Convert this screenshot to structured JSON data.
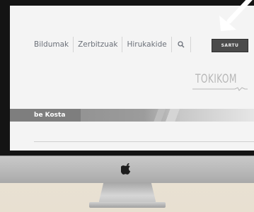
{
  "nav": {
    "items": [
      {
        "label": "Bildumak"
      },
      {
        "label": "Zerbitzuak"
      },
      {
        "label": "Hirukakide"
      }
    ],
    "search_icon": "search-icon",
    "login_label": "SARTU"
  },
  "logo": {
    "text": "TOKIKOM"
  },
  "banner": {
    "title": "be Kosta"
  },
  "hardware": {
    "logo_icon": "apple-logo-icon"
  },
  "colors": {
    "login_button_bg": "#4b4b4b",
    "banner_bg": "#8a8a8a",
    "arrow": "#ffffff"
  }
}
